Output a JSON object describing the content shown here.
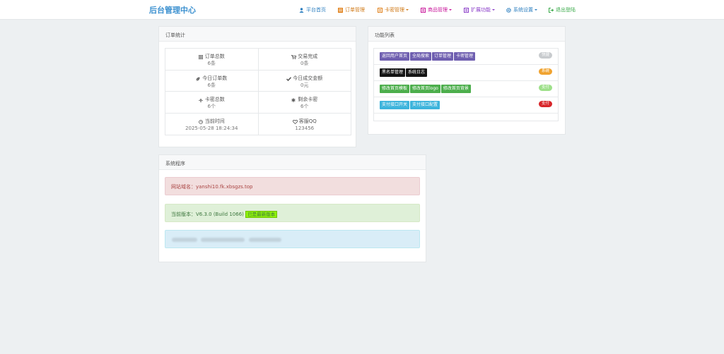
{
  "navbar": {
    "brand": "后台管理中心",
    "items": [
      {
        "label": "平台首页",
        "icon": "user-icon",
        "color": "#2f80c0",
        "caret": false
      },
      {
        "label": "订单管理",
        "icon": "list-icon",
        "color": "#e0801a",
        "caret": false
      },
      {
        "label": "卡密管理",
        "icon": "book-icon",
        "color": "#e0801a",
        "caret": true
      },
      {
        "label": "商品管理",
        "icon": "book-icon",
        "color": "#c8159a",
        "caret": true
      },
      {
        "label": "扩展功能",
        "icon": "book-icon",
        "color": "#8a3cc8",
        "caret": true
      },
      {
        "label": "系统设置",
        "icon": "gear-icon",
        "color": "#2f80c0",
        "caret": true
      },
      {
        "label": "退出登陆",
        "icon": "logout-icon",
        "color": "#3aaa4a",
        "caret": false
      }
    ]
  },
  "order_stats": {
    "title": "订单统计",
    "rows": [
      [
        {
          "label": "订单总数",
          "value": "6条",
          "icon": "grid-icon"
        },
        {
          "label": "交易完成",
          "value": "0条",
          "icon": "cart-icon"
        }
      ],
      [
        {
          "label": "今日订单数",
          "value": "6条",
          "icon": "leaf-icon"
        },
        {
          "label": "今日成交金额",
          "value": "0元",
          "icon": "check-icon"
        }
      ],
      [
        {
          "label": "卡密总数",
          "value": "6个",
          "icon": "plane-icon"
        },
        {
          "label": "剩余卡密",
          "value": "6个",
          "icon": "asterisk-icon"
        }
      ],
      [
        {
          "label": "当前时间",
          "value": "2025-05-28 18:24:34",
          "icon": "clock-icon"
        },
        {
          "label": "客服QQ",
          "value": "123456",
          "icon": "heart-icon"
        }
      ]
    ]
  },
  "function_list": {
    "title": "功能列表",
    "rows": [
      {
        "tags": [
          "返回用户首页",
          "全局搜索",
          "订单管理",
          "卡密管理"
        ],
        "tag_color": "#6f5fb0",
        "badge": "快捷",
        "badge_color": "#c8cbce"
      },
      {
        "tags": [
          "黑名单管理",
          "系统日志"
        ],
        "tag_color": "#141414",
        "badge": "系统",
        "badge_color": "#f0a330"
      },
      {
        "tags": [
          "修改首页模板",
          "修改首页logo",
          "修改首页背景"
        ],
        "tag_color": "#4cae4c",
        "badge": "支付",
        "badge_color": "#9ee08a"
      },
      {
        "tags": [
          "支付接口开关",
          "支付接口配置"
        ],
        "tag_color": "#3db4dc",
        "badge": "支付",
        "badge_color": "#d8262a"
      }
    ]
  },
  "system": {
    "title": "系统程序",
    "domain": "网站域名：yanshi10.fk.xbsgzs.top",
    "version": "当前版本：V6.3.0 (Build 1066)",
    "latest": "已是最新版本"
  }
}
